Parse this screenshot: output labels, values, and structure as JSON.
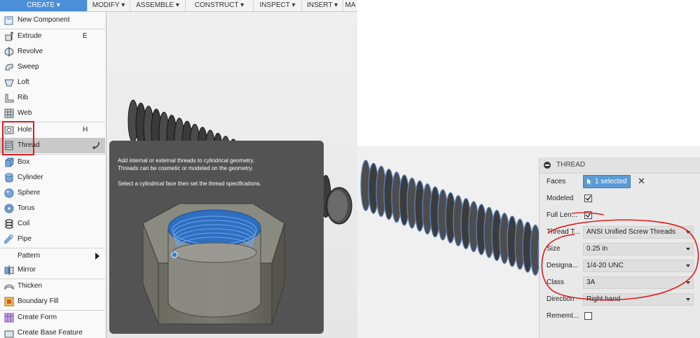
{
  "toolbar": {
    "items": [
      "CREATE ▾",
      "MODIFY ▾",
      "ASSEMBLE ▾",
      "CONSTRUCT ▾",
      "INSPECT ▾",
      "INSERT ▾",
      "MA"
    ]
  },
  "create_menu": {
    "new_component": "New Component",
    "extrude": "Extrude",
    "extrude_shortcut": "E",
    "revolve": "Revolve",
    "sweep": "Sweep",
    "loft": "Loft",
    "rib": "Rib",
    "web": "Web",
    "hole": "Hole",
    "hole_shortcut": "H",
    "thread": "Thread",
    "box": "Box",
    "cylinder": "Cylinder",
    "sphere": "Sphere",
    "torus": "Torus",
    "coil": "Coil",
    "pipe": "Pipe",
    "pattern": "Pattern",
    "mirror": "Mirror",
    "thicken": "Thicken",
    "boundary_fill": "Boundary Fill",
    "create_form": "Create Form",
    "create_base_feature": "Create Base Feature"
  },
  "tooltip": {
    "line1": "Add internal or external threads to cylindrical geometry.",
    "line2": "Threads can be cosmetic or modeled on the geometry.",
    "line3": "Select a cylindrical face then set the thread specifications."
  },
  "thread_panel": {
    "title": "THREAD",
    "faces_label": "Faces",
    "faces_value": "1 selected",
    "modeled_label": "Modeled",
    "full_length_label": "Full Len...",
    "thread_type_label": "Thread T...",
    "thread_type_value": "ANSI Unified Screw Threads",
    "size_label": "Size",
    "size_value": "0.25 in",
    "designation_label": "Designa...",
    "designation_value": "1/4-20 UNC",
    "class_label": "Class",
    "class_value": "3A",
    "direction_label": "Direction",
    "direction_value": "Right hand",
    "remember_label": "Rememt..."
  },
  "colors": {
    "accent": "#4a8fd8",
    "highlight_red": "#e01b1b",
    "tooltip_bg": "#535353"
  }
}
